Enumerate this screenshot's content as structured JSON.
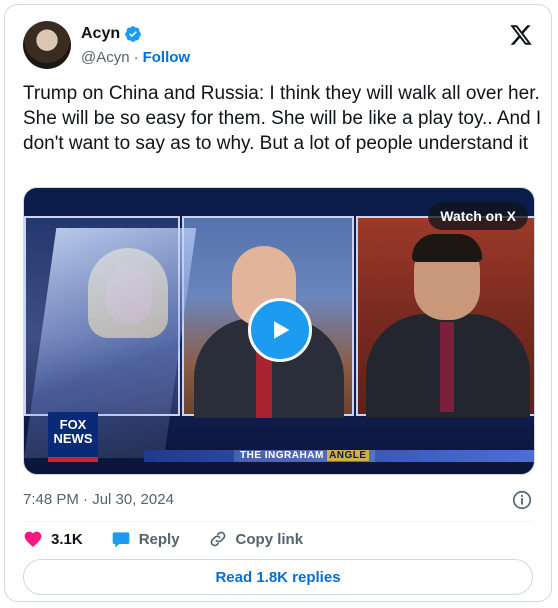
{
  "author": {
    "display_name": "Acyn",
    "handle": "@Acyn",
    "follow_label": "Follow"
  },
  "tweet": {
    "text": "Trump on China and Russia: I think they will walk all over her. She will be so easy for them. She will be like a play toy.. And I don't want to say as to why. But a lot of people understand it",
    "timestamp": "7:48 PM · Jul 30, 2024"
  },
  "media": {
    "watch_label": "Watch on X",
    "chyron_prefix": "THE INGRAHAM ",
    "chyron_highlight": "ANGLE",
    "logo_line1": "FOX",
    "logo_line2": "NEWS"
  },
  "actions": {
    "likes": "3.1K",
    "reply_label": "Reply",
    "copy_link_label": "Copy link"
  },
  "read_replies_label": "Read 1.8K replies",
  "colors": {
    "accent": "#1d9bf0",
    "link": "#006fd6",
    "like": "#f91880",
    "muted": "#536471"
  },
  "icons": {
    "verified": "verified-badge-icon",
    "x_logo": "x-logo-icon",
    "info": "info-icon",
    "like": "heart-icon",
    "reply": "speech-bubble-icon",
    "copy_link": "link-icon",
    "play": "play-icon"
  }
}
